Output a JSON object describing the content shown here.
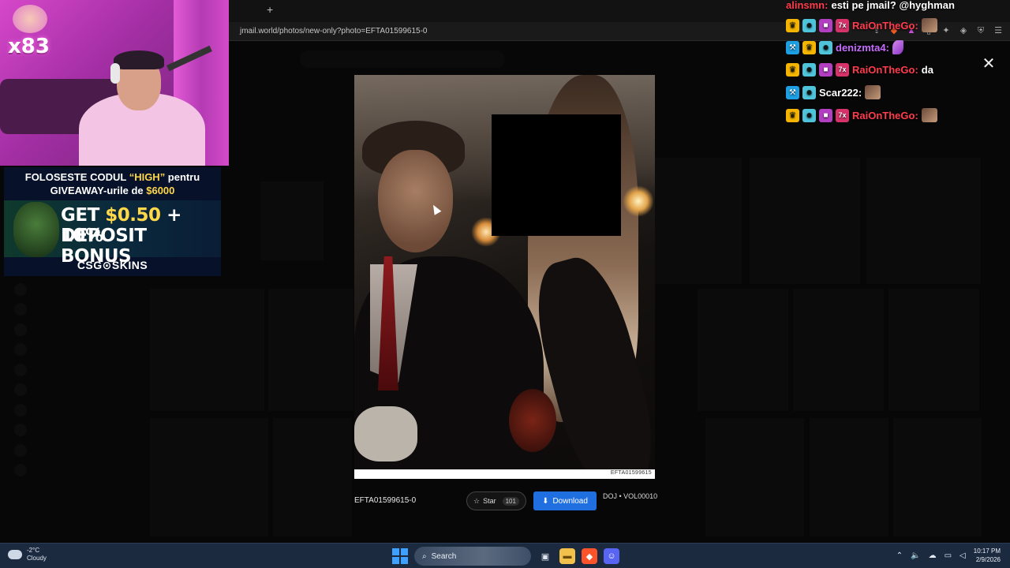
{
  "browser": {
    "new_tab": "+",
    "url": "jmail.world/photos/new-only?photo=EFTA01599615-0"
  },
  "viewer": {
    "close": "✕",
    "photo_label": "EFTA01599615",
    "photo_id": "EFTA01599615-0",
    "star_label": "Star",
    "star_count": "101",
    "download_label": "Download",
    "source": "DOJ • VOL00010"
  },
  "webcam": {
    "combo": "x83"
  },
  "sponsor": {
    "line1_pre": "FOLOSESTE CODUL ",
    "line1_code": "“HIGH”",
    "line1_post": " pentru",
    "line2_pre": "GIVEAWAY-urile de ",
    "line2_amount": "$6000",
    "offer_pre": "GET ",
    "offer_amount": "$0.50",
    "offer_post": " + 10%",
    "offer_line2": "DEPOSIT BONUS",
    "brand": "CSG⊙SKINS"
  },
  "chat": {
    "messages": [
      {
        "user": "alinsmn:",
        "text": "esti pe jmail? @hyghman"
      },
      {
        "user": "RaiOnTheGo:",
        "text": ""
      },
      {
        "user": "denizmta4:",
        "text": ""
      },
      {
        "user": "RaiOnTheGo:",
        "text": "da"
      },
      {
        "user": "Scar222:",
        "text": ""
      },
      {
        "user": "RaiOnTheGo:",
        "text": ""
      }
    ]
  },
  "taskbar": {
    "temperature": "-2°C",
    "condition": "Cloudy",
    "search_label": "Search",
    "time": "10:17 PM",
    "date": "2/9/2026"
  },
  "colors": {
    "download_button": "#1f6fe0",
    "chat_user_red": "#ff3c4c",
    "chat_user_purple": "#c76bff",
    "sponsor_highlight": "#ffd84a"
  }
}
